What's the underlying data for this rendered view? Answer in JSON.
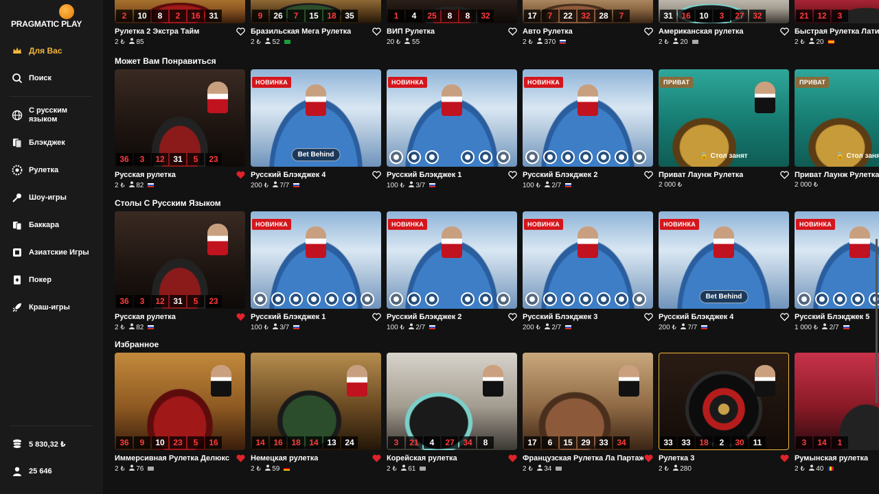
{
  "brand": {
    "name": "PRAGMATIC PLAY"
  },
  "sidebar": {
    "items": [
      {
        "label": "Для Вас",
        "icon": "crown-icon",
        "active": true
      },
      {
        "label": "Поиск",
        "icon": "search-icon"
      },
      {
        "label": "С русским языком",
        "icon": "globe-icon"
      },
      {
        "label": "Блэкджек",
        "icon": "cards-icon"
      },
      {
        "label": "Рулетка",
        "icon": "roulette-icon"
      },
      {
        "label": "Шоу-игры",
        "icon": "microphone-icon"
      },
      {
        "label": "Баккара",
        "icon": "baccarat-icon"
      },
      {
        "label": "Азиатские Игры",
        "icon": "dragon-icon"
      },
      {
        "label": "Покер",
        "icon": "poker-icon"
      },
      {
        "label": "Краш-игры",
        "icon": "rocket-icon"
      }
    ],
    "balance": "5 830,32 ₺",
    "players": "25 646"
  },
  "sections": {
    "top": {
      "cards": [
        {
          "title": "Рулетка 2 Экстра Тайм",
          "bet": "2 ₺",
          "players": "85",
          "flag": "",
          "results": [
            [
              "2",
              "r"
            ],
            [
              "10",
              "b"
            ],
            [
              "8",
              "b"
            ],
            [
              "2",
              "r"
            ],
            [
              "16",
              "r"
            ],
            [
              "31",
              "b"
            ]
          ]
        },
        {
          "title": "Бразильская Мега Рулетка",
          "bet": "2 ₺",
          "players": "52",
          "flag": "br",
          "results": [
            [
              "9",
              "r"
            ],
            [
              "26",
              "b"
            ],
            [
              "7",
              "r"
            ],
            [
              "15",
              "b"
            ],
            [
              "18",
              "r"
            ],
            [
              "35",
              "b"
            ]
          ]
        },
        {
          "title": "ВИП Рулетка",
          "bet": "20 ₺",
          "players": "55",
          "flag": "",
          "results": [
            [
              "1",
              "r"
            ],
            [
              "4",
              "b"
            ],
            [
              "25",
              "r"
            ],
            [
              "8",
              "b"
            ],
            [
              "8",
              "b"
            ],
            [
              "32",
              "r"
            ]
          ]
        },
        {
          "title": "Авто Рулетка",
          "bet": "2 ₺",
          "players": "370",
          "flag": "ru",
          "results": [
            [
              "17",
              "b"
            ],
            [
              "7",
              "r"
            ],
            [
              "22",
              "b"
            ],
            [
              "32",
              "r"
            ],
            [
              "28",
              "b"
            ],
            [
              "7",
              "r"
            ]
          ]
        },
        {
          "title": "Американская рулетка",
          "bet": "2 ₺",
          "players": "20",
          "flag": "gen",
          "results": [
            [
              "31",
              "b"
            ],
            [
              "16",
              "r"
            ],
            [
              "10",
              "b"
            ],
            [
              "3",
              "r"
            ],
            [
              "27",
              "r"
            ],
            [
              "32",
              "r"
            ]
          ]
        },
        {
          "title": "Быстрая Рулетка Латин",
          "bet": "2 ₺",
          "players": "20",
          "flag": "es",
          "results": [
            [
              "21",
              "r"
            ],
            [
              "12",
              "r"
            ],
            [
              "3",
              "r"
            ]
          ]
        }
      ]
    },
    "may_like": {
      "title": "Может Вам Понравиться",
      "cards": [
        {
          "title": "Русская рулетка",
          "bet": "2 ₺",
          "players": "82",
          "flag": "ru",
          "fav": true,
          "badge": "",
          "results": [
            [
              "36",
              "r"
            ],
            [
              "3",
              "r"
            ],
            [
              "12",
              "r"
            ],
            [
              "31",
              "b"
            ],
            [
              "5",
              "r"
            ],
            [
              "23",
              "r"
            ]
          ]
        },
        {
          "title": "Русский Блэкджек 4",
          "bet": "200 ₺",
          "players": "7/7",
          "flag": "ru",
          "fav": false,
          "badge": "НОВИНКА",
          "pill": "Bet Behind"
        },
        {
          "title": "Русский Блэкджек 1",
          "bet": "100 ₺",
          "players": "3/7",
          "flag": "ru",
          "fav": false,
          "badge": "НОВИНКА"
        },
        {
          "title": "Русский Блэкджек 2",
          "bet": "100 ₺",
          "players": "2/7",
          "flag": "ru",
          "fav": false,
          "badge": "НОВИНКА"
        },
        {
          "title": "Приват Лаунж Рулетка",
          "bet": "2 000 ₺",
          "players": "",
          "flag": "",
          "fav": false,
          "badge": "ПРИВАТ",
          "occupied": "Стол занят"
        },
        {
          "title": "Приват Лаунж Рулетка",
          "bet": "2 000 ₺",
          "players": "",
          "flag": "",
          "fav": false,
          "badge": "ПРИВАТ",
          "occupied": "Стол занят"
        }
      ]
    },
    "russian": {
      "title": "Столы С Русским Языком",
      "cards": [
        {
          "title": "Русская рулетка",
          "bet": "2 ₺",
          "players": "82",
          "flag": "ru",
          "fav": true,
          "badge": "",
          "results": [
            [
              "36",
              "r"
            ],
            [
              "3",
              "r"
            ],
            [
              "12",
              "r"
            ],
            [
              "31",
              "b"
            ],
            [
              "5",
              "r"
            ],
            [
              "23",
              "r"
            ]
          ]
        },
        {
          "title": "Русский Блэкджек 1",
          "bet": "100 ₺",
          "players": "3/7",
          "flag": "ru",
          "fav": false,
          "badge": "НОВИНКА"
        },
        {
          "title": "Русский Блэкджек 2",
          "bet": "100 ₺",
          "players": "2/7",
          "flag": "ru",
          "fav": false,
          "badge": "НОВИНКА"
        },
        {
          "title": "Русский Блэкджек 3",
          "bet": "200 ₺",
          "players": "2/7",
          "flag": "ru",
          "fav": false,
          "badge": "НОВИНКА"
        },
        {
          "title": "Русский Блэкджек 4",
          "bet": "200 ₺",
          "players": "7/7",
          "flag": "ru",
          "fav": false,
          "badge": "НОВИНКА",
          "pill": "Bet Behind"
        },
        {
          "title": "Русский Блэкджек 5",
          "bet": "1 000 ₺",
          "players": "2/7",
          "flag": "ru",
          "fav": false,
          "badge": "НОВИНКА"
        }
      ]
    },
    "favorites": {
      "title": "Избранное",
      "cards": [
        {
          "title": "Иммерсивная Рулетка Делюкс",
          "bet": "2 ₺",
          "players": "76",
          "flag": "gen",
          "fav": true,
          "results": [
            [
              "36",
              "r"
            ],
            [
              "9",
              "r"
            ],
            [
              "10",
              "b"
            ],
            [
              "23",
              "r"
            ],
            [
              "5",
              "r"
            ],
            [
              "16",
              "r"
            ]
          ]
        },
        {
          "title": "Немецкая рулетка",
          "bet": "2 ₺",
          "players": "59",
          "flag": "de",
          "fav": true,
          "results": [
            [
              "14",
              "r"
            ],
            [
              "16",
              "r"
            ],
            [
              "18",
              "r"
            ],
            [
              "14",
              "r"
            ],
            [
              "13",
              "b"
            ],
            [
              "24",
              "b"
            ]
          ]
        },
        {
          "title": "Корейская рулетка",
          "bet": "2 ₺",
          "players": "61",
          "flag": "gen",
          "fav": true,
          "results": [
            [
              "3",
              "r"
            ],
            [
              "21",
              "r"
            ],
            [
              "4",
              "b"
            ],
            [
              "27",
              "r"
            ],
            [
              "34",
              "r"
            ],
            [
              "8",
              "b"
            ]
          ]
        },
        {
          "title": "Французская Рулетка Ла Партаж",
          "bet": "2 ₺",
          "players": "34",
          "flag": "gen",
          "fav": true,
          "results": [
            [
              "17",
              "b"
            ],
            [
              "6",
              "b"
            ],
            [
              "15",
              "b"
            ],
            [
              "29",
              "b"
            ],
            [
              "33",
              "b"
            ],
            [
              "34",
              "r"
            ]
          ]
        },
        {
          "title": "Рулетка 3",
          "bet": "2 ₺",
          "players": "280",
          "flag": "",
          "fav": true,
          "results": [
            [
              "33",
              "b"
            ],
            [
              "33",
              "b"
            ],
            [
              "18",
              "r"
            ],
            [
              "2",
              "b"
            ],
            [
              "30",
              "r"
            ],
            [
              "11",
              "b"
            ]
          ]
        },
        {
          "title": "Румынская рулетка",
          "bet": "2 ₺",
          "players": "40",
          "flag": "ro",
          "fav": false,
          "results": [
            [
              "3",
              "r"
            ],
            [
              "14",
              "r"
            ],
            [
              "1",
              "r"
            ]
          ]
        }
      ]
    }
  }
}
